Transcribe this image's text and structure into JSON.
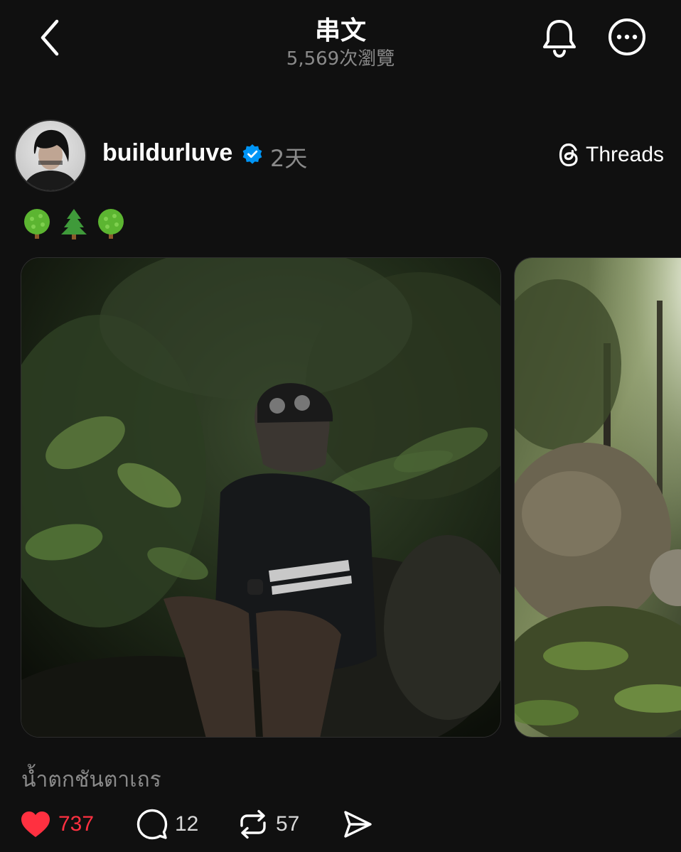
{
  "header": {
    "title": "串文",
    "views": "5,569次瀏覽",
    "back_icon": "chevron-left-icon",
    "bell_icon": "bell-icon",
    "more_icon": "more-horizontal-icon"
  },
  "post": {
    "username": "buildurluve",
    "verified": true,
    "time": "2天",
    "threads_label": "Threads",
    "emojis": [
      "🌳",
      "🌲",
      "🌳"
    ],
    "photos": [
      {
        "description_icon": "photo-person-in-forest"
      },
      {
        "description_icon": "photo-forest-boulders"
      }
    ],
    "caption": "น้ำตกชันตาเถร",
    "actions": {
      "likes": "737",
      "liked": true,
      "comments": "12",
      "reposts": "57"
    }
  },
  "colors": {
    "background": "#101010",
    "accent_like": "#ff3040",
    "verified_blue": "#0095f6",
    "muted_text": "#8a8a8a"
  }
}
